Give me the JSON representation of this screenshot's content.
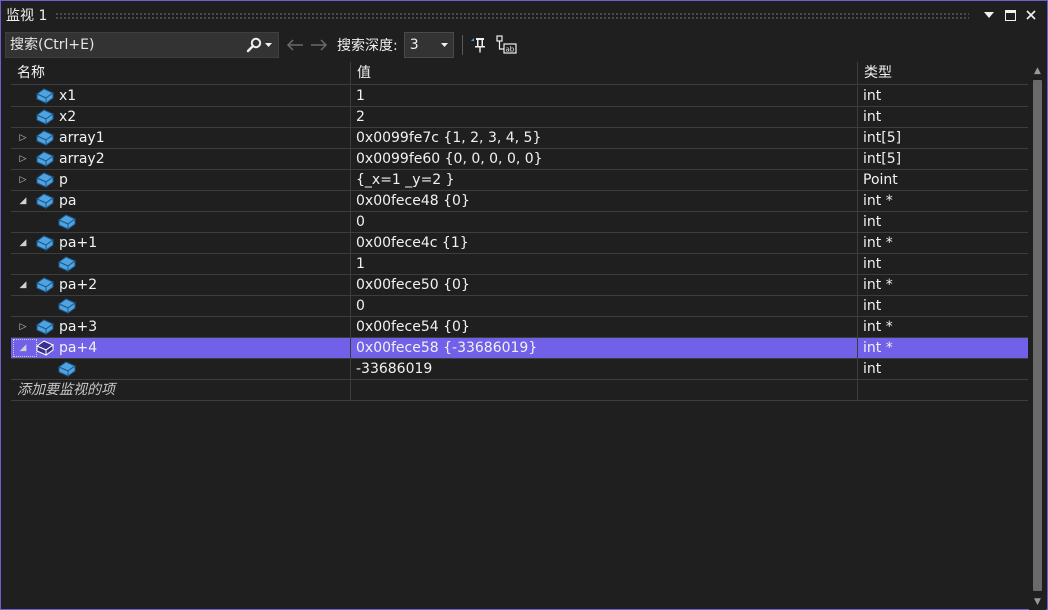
{
  "window": {
    "title": "监视 1",
    "buttons": [
      "dropdown-arrow",
      "maximize",
      "close"
    ]
  },
  "toolbar": {
    "search_placeholder": "搜索(Ctrl+E)",
    "depth_label": "搜索深度:",
    "depth_value": "3",
    "icons": [
      "search-icon",
      "back-arrow-icon",
      "forward-arrow-icon",
      "pin-icon",
      "format-icon"
    ]
  },
  "columns": {
    "name": "名称",
    "value": "值",
    "type": "类型"
  },
  "rows": [
    {
      "name": "x1",
      "value": "1",
      "type": "int",
      "level": 0,
      "expander": "none"
    },
    {
      "name": "x2",
      "value": "2",
      "type": "int",
      "level": 0,
      "expander": "none"
    },
    {
      "name": "array1",
      "value": "0x0099fe7c {1, 2, 3, 4, 5}",
      "type": "int[5]",
      "level": 0,
      "expander": "collapsed"
    },
    {
      "name": "array2",
      "value": "0x0099fe60 {0, 0, 0, 0, 0}",
      "type": "int[5]",
      "level": 0,
      "expander": "collapsed"
    },
    {
      "name": "p",
      "value": "{_x=1 _y=2 }",
      "type": "Point",
      "level": 0,
      "expander": "collapsed"
    },
    {
      "name": "pa",
      "value": "0x00fece48 {0}",
      "type": "int *",
      "level": 0,
      "expander": "expanded"
    },
    {
      "name": "",
      "value": "0",
      "type": "int",
      "level": 1,
      "expander": "none"
    },
    {
      "name": "pa+1",
      "value": "0x00fece4c {1}",
      "type": "int *",
      "level": 0,
      "expander": "expanded"
    },
    {
      "name": "",
      "value": "1",
      "type": "int",
      "level": 1,
      "expander": "none"
    },
    {
      "name": "pa+2",
      "value": "0x00fece50 {0}",
      "type": "int *",
      "level": 0,
      "expander": "expanded"
    },
    {
      "name": "",
      "value": "0",
      "type": "int",
      "level": 1,
      "expander": "none"
    },
    {
      "name": "pa+3",
      "value": "0x00fece54 {0}",
      "type": "int *",
      "level": 0,
      "expander": "collapsed"
    },
    {
      "name": "pa+4",
      "value": "0x00fece58 {-33686019}",
      "type": "int *",
      "level": 0,
      "expander": "expanded",
      "selected": true
    },
    {
      "name": "",
      "value": "-33686019",
      "type": "int",
      "level": 1,
      "expander": "none"
    }
  ],
  "add_item_text": "添加要监视的项",
  "colors": {
    "background": "#1f1f1f",
    "selection": "#7160e8",
    "border_accent": "#6e5fc9",
    "icon_blue": "#4fa3e0"
  }
}
